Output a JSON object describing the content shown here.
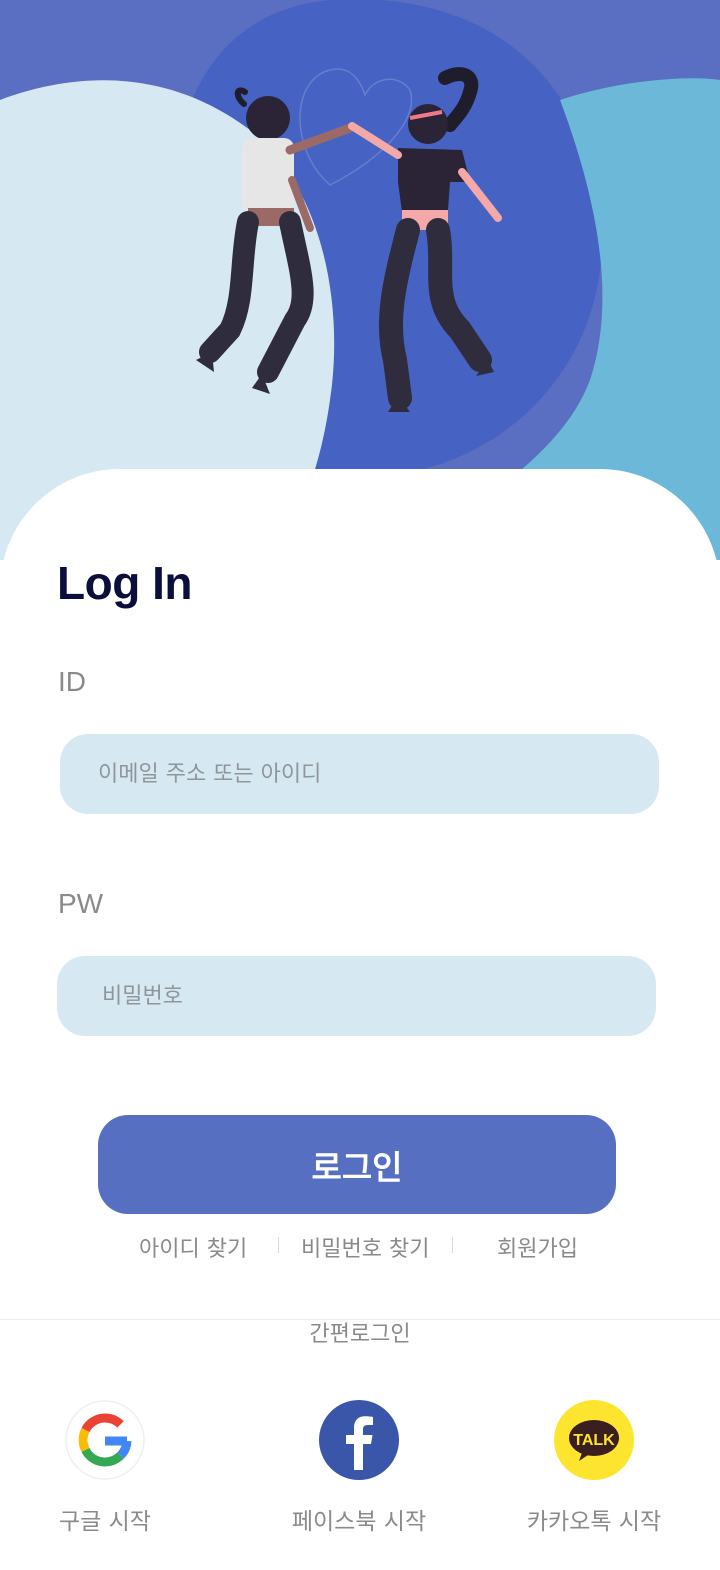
{
  "colors": {
    "hero_background": "#5a6fc1",
    "hero_blob_light": "#d6e9f2",
    "hero_blob_dark": "#4662c2",
    "hero_blob_teal": "#6bb8d9",
    "primary_button": "#566fc1",
    "input_background": "#d6e9f2",
    "title_text": "#0b0d3a",
    "muted_text": "#8a8a8a"
  },
  "hero": {
    "illustration": "two-people-jumping-high-five"
  },
  "login": {
    "title": "Log In",
    "id_label": "ID",
    "id_placeholder": "이메일 주소 또는 아이디",
    "pw_label": "PW",
    "pw_placeholder": "비밀번호",
    "submit_label": "로그인"
  },
  "links": {
    "find_id": "아이디 찾기",
    "find_password": "비밀번호 찾기",
    "sign_up": "회원가입"
  },
  "easy_login": {
    "heading": "간편로그인",
    "providers": [
      {
        "id": "google",
        "icon": "google-icon",
        "label": "구글 시작"
      },
      {
        "id": "facebook",
        "icon": "facebook-icon",
        "label": "페이스북 시작"
      },
      {
        "id": "kakao",
        "icon": "kakaotalk-icon",
        "label": "카카오톡 시작",
        "badge": "TALK"
      }
    ]
  }
}
